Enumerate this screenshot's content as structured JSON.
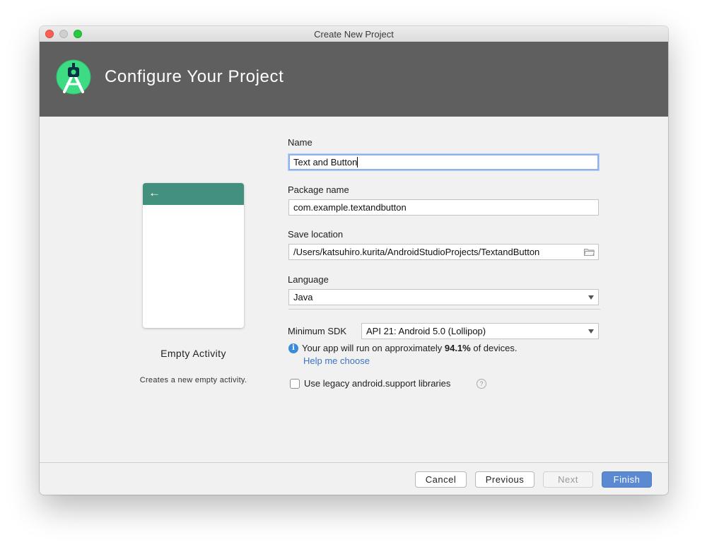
{
  "window": {
    "title": "Create New Project"
  },
  "header": {
    "title": "Configure Your Project",
    "logo_icon": "android-studio-logo-icon"
  },
  "template": {
    "name": "Empty Activity",
    "description": "Creates a new empty activity.",
    "preview_back_icon": "←"
  },
  "form": {
    "name_label": "Name",
    "name_value": "Text and Button",
    "package_label": "Package name",
    "package_value": "com.example.textandbutton",
    "save_label": "Save location",
    "save_value": "/Users/katsuhiro.kurita/AndroidStudioProjects/TextandButton",
    "language_label": "Language",
    "language_value": "Java",
    "min_sdk_label": "Minimum SDK",
    "min_sdk_value": "API 21: Android 5.0 (Lollipop)",
    "info_prefix": "Your app will run on approximately ",
    "info_percent": "94.1%",
    "info_suffix": " of devices.",
    "help_link": "Help me choose",
    "legacy_label": "Use legacy android.support libraries",
    "legacy_checked": false
  },
  "buttons": {
    "cancel": "Cancel",
    "previous": "Previous",
    "next": "Next",
    "finish": "Finish"
  },
  "colors": {
    "header_bg": "#5f5f5f",
    "preview_bar": "#44907f",
    "primary_button": "#5b8ad2",
    "link": "#3d73c4"
  }
}
